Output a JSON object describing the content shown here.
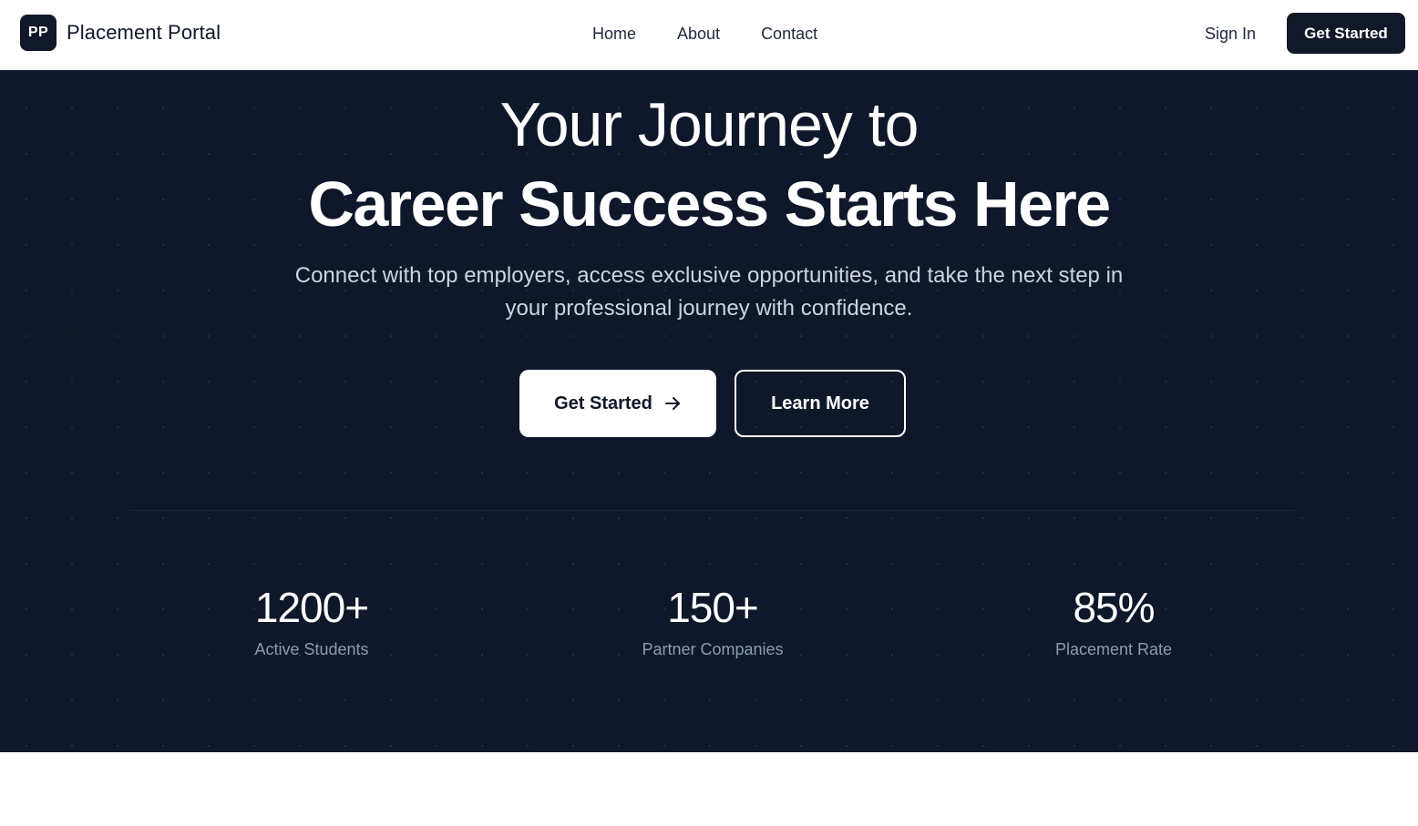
{
  "navbar": {
    "brand_initials": "PP",
    "brand_name": "Placement Portal",
    "links": [
      {
        "label": "Home"
      },
      {
        "label": "About"
      },
      {
        "label": "Contact"
      }
    ],
    "signin_label": "Sign In",
    "cta_label": "Get Started"
  },
  "hero": {
    "title_line1": "Your Journey to",
    "title_line2": "Career Success Starts Here",
    "subtitle": "Connect with top employers, access exclusive opportunities, and take the next step in your professional journey with confidence.",
    "primary_button": {
      "label": "Get Started",
      "icon": "arrow-right-icon"
    },
    "secondary_button": {
      "label": "Learn More"
    },
    "stats": [
      {
        "value": "1200+",
        "label": "Active Students"
      },
      {
        "value": "150+",
        "label": "Partner Companies"
      },
      {
        "value": "85%",
        "label": "Placement Rate"
      }
    ]
  },
  "colors": {
    "hero_background": "#0f172a",
    "brand_dark": "#111827",
    "white": "#ffffff",
    "muted_text": "#cbd5e1",
    "stat_label": "#8b9bb4"
  }
}
